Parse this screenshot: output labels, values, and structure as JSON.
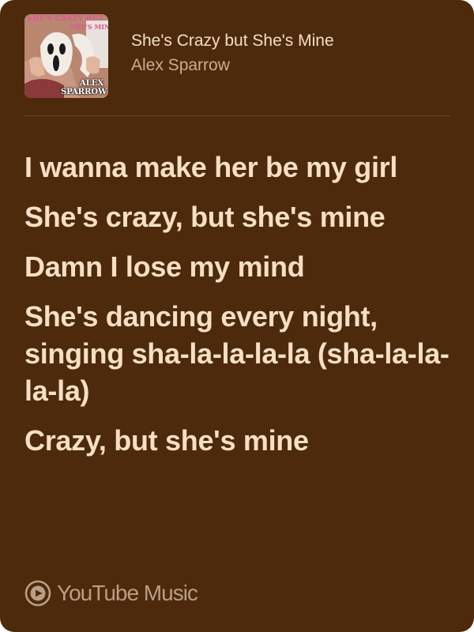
{
  "colors": {
    "background": "#4d2a0c",
    "lyric_text": "#f6dfc5",
    "title_text": "#f4dec6",
    "artist_text": "#c9ae94",
    "brand_text": "#b99e85",
    "divider": "#6f4a29"
  },
  "track": {
    "title": "She's Crazy but She's Mine",
    "artist": "Alex Sparrow",
    "album_art": {
      "icon": "album-art-image",
      "title_line_1": "SHE'S CRAZY BUT",
      "title_line_2": "SHE'S MINE",
      "artist_line_1": "ALEX",
      "artist_line_2": "SPARROW"
    }
  },
  "lyrics": [
    "I wanna make her be my girl",
    "She's crazy, but she's mine",
    "Damn I lose my mind",
    "She's dancing every night, singing sha-la-la-la-la (sha-la-la-la-la)",
    "Crazy, but she's mine"
  ],
  "brand": {
    "icon": "youtube-music-icon",
    "name": "YouTube Music"
  }
}
